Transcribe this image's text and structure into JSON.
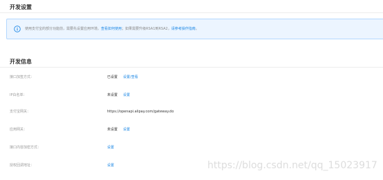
{
  "dev_settings": {
    "title": "开发设置"
  },
  "notice": {
    "text_before_link1": "使用支付宝的部分功能前，需要先设置应用环境。",
    "link1": "查看如何使用",
    "text_between": "；如果需要升级RSA1到RSA2，",
    "link2": "请参考操作指南",
    "text_after": "。",
    "icon": "info-circle-icon"
  },
  "dev_info": {
    "title": "开发信息",
    "rows": [
      {
        "label": "接口加签方式：",
        "status": "已设置",
        "action": "设置/查看"
      },
      {
        "label": "IP白名单：",
        "status": "未设置",
        "action": "设置"
      },
      {
        "label": "支付宝网关：",
        "url": "https://openapi.alipay.com/gateway.do"
      },
      {
        "label": "应用网关：",
        "status": "未设置",
        "action": "设置"
      },
      {
        "label": "接口内容加密方式：",
        "action": "设置"
      },
      {
        "label": "授权回调地址：",
        "action": "设置"
      }
    ]
  },
  "watermark": "https://blog.csdn.net/qq_15023917",
  "colors": {
    "link": "#1e88e5",
    "notice_bg": "#ecf5ff",
    "notice_border": "#b3d8ff",
    "label": "#999999"
  }
}
